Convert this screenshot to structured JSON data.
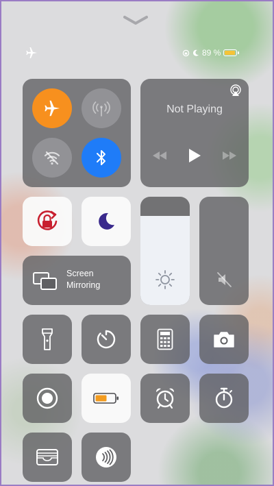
{
  "status": {
    "battery_text": "89 %",
    "battery_level": 0.89
  },
  "connectivity": {
    "airplane": {
      "icon": "airplane-icon",
      "active": true
    },
    "cellular": {
      "icon": "cellular-antenna-icon",
      "active": false
    },
    "wifi": {
      "icon": "wifi-off-icon",
      "active": false
    },
    "bluetooth": {
      "icon": "bluetooth-icon",
      "active": true
    }
  },
  "now_playing": {
    "title": "Not Playing",
    "airplay_icon": "airplay-icon",
    "controls": [
      "rewind-icon",
      "play-icon",
      "fast-forward-icon"
    ]
  },
  "toggles": {
    "rotation_lock": {
      "icon": "rotation-lock-icon",
      "active": true
    },
    "do_not_disturb": {
      "icon": "moon-icon",
      "active": true
    }
  },
  "screen_mirroring": {
    "line1": "Screen",
    "line2": "Mirroring",
    "icon": "screen-mirroring-icon"
  },
  "brightness": {
    "level": 0.82,
    "icon": "sun-icon"
  },
  "volume": {
    "level": 0.0,
    "icon": "speaker-muted-icon"
  },
  "shortcuts": [
    "flashlight-icon",
    "timer-icon",
    "calculator-icon",
    "camera-icon",
    "screen-record-icon",
    "low-power-battery-icon",
    "alarm-clock-icon",
    "stopwatch-icon",
    "wallet-icon",
    "nfc-reader-icon"
  ],
  "colors": {
    "airplane_active": "#f7901e",
    "bluetooth_active": "#1f7cf8",
    "rotation_lock": "#c8202f",
    "dnd_moon": "#3a2a8c",
    "battery_yellow": "#f5c338",
    "low_power_orange": "#f29b1f"
  }
}
